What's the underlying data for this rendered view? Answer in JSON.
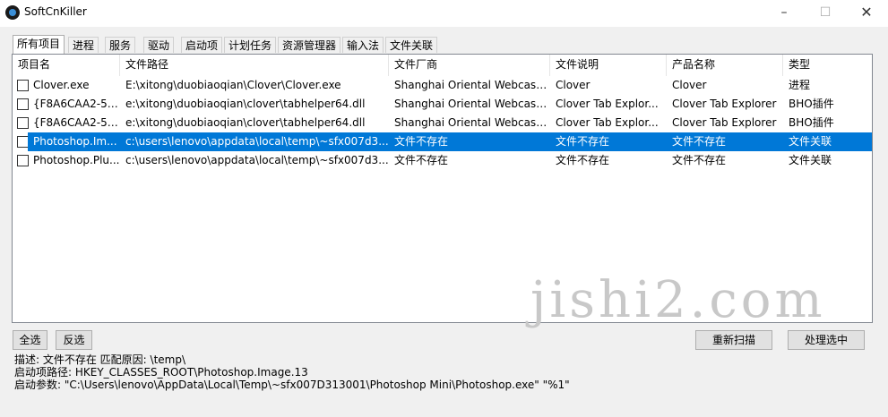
{
  "window": {
    "title": "SoftCnKiller",
    "controls": {
      "minimize": "–",
      "maximize": "☐",
      "close": "✕"
    }
  },
  "tabs": [
    {
      "label": "所有项目",
      "active": true
    },
    {
      "label": "进程"
    },
    {
      "label": "服务"
    },
    {
      "label": "驱动"
    },
    {
      "label": "启动项"
    },
    {
      "label": "计划任务"
    },
    {
      "label": "资源管理器"
    },
    {
      "label": "输入法"
    },
    {
      "label": "文件关联"
    }
  ],
  "list": {
    "columns": [
      "项目名",
      "文件路径",
      "文件厂商",
      "文件说明",
      "产品名称",
      "类型"
    ],
    "rows": [
      {
        "checked": false,
        "selected": false,
        "cells": [
          "Clover.exe",
          "E:\\xitong\\duobiaoqian\\Clover\\Clover.exe",
          "Shanghai Oriental Webcast...",
          "Clover",
          "Clover",
          "进程"
        ]
      },
      {
        "checked": false,
        "selected": false,
        "cells": [
          "{F8A6CAA2-53...",
          "e:\\xitong\\duobiaoqian\\clover\\tabhelper64.dll",
          "Shanghai Oriental Webcast...",
          "Clover Tab Explor...",
          "Clover Tab Explorer",
          "BHO插件"
        ]
      },
      {
        "checked": false,
        "selected": false,
        "cells": [
          "{F8A6CAA2-53...",
          "e:\\xitong\\duobiaoqian\\clover\\tabhelper64.dll",
          "Shanghai Oriental Webcast...",
          "Clover Tab Explor...",
          "Clover Tab Explorer",
          "BHO插件"
        ]
      },
      {
        "checked": false,
        "selected": true,
        "cells": [
          "Photoshop.Im...",
          "c:\\users\\lenovo\\appdata\\local\\temp\\~sfx007d3...",
          "文件不存在",
          "文件不存在",
          "文件不存在",
          "文件关联"
        ]
      },
      {
        "checked": false,
        "selected": false,
        "cells": [
          "Photoshop.Plu...",
          "c:\\users\\lenovo\\appdata\\local\\temp\\~sfx007d3...",
          "文件不存在",
          "文件不存在",
          "文件不存在",
          "文件关联"
        ]
      }
    ]
  },
  "watermark": "jishi2.com",
  "buttons": {
    "select_all": "全选",
    "invert": "反选",
    "rescan": "重新扫描",
    "process_selected": "处理选中"
  },
  "details": {
    "description": "描述:  文件不存在   匹配原因: \\temp\\",
    "startup_path": "启动项路径:  HKEY_CLASSES_ROOT\\Photoshop.Image.13",
    "startup_args": "启动参数:  \"C:\\Users\\lenovo\\AppData\\Local\\Temp\\~sfx007D313001\\Photoshop Mini\\Photoshop.exe\" \"%1\""
  },
  "colors": {
    "selection": "#0078d7",
    "window_bg": "#f0f0f0"
  }
}
